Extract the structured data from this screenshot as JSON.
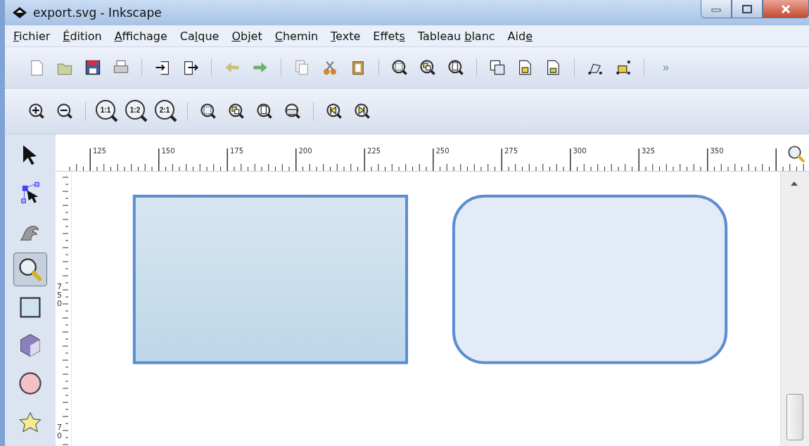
{
  "window": {
    "title": "export.svg - Inkscape"
  },
  "menu": [
    {
      "key": "F",
      "after": "ichier"
    },
    {
      "key": "É",
      "after": "dition"
    },
    {
      "key": "A",
      "after": "ffichage"
    },
    {
      "before": "Ca",
      "key": "l",
      "after": "que"
    },
    {
      "key": "O",
      "after": "bjet"
    },
    {
      "key": "C",
      "after": "hemin"
    },
    {
      "key": "T",
      "after": "exte"
    },
    {
      "before": "Effet",
      "key": "s"
    },
    {
      "before": "Tableau ",
      "key": "b",
      "after": "lanc"
    },
    {
      "before": "Aid",
      "key": "e"
    }
  ],
  "toolbar": {
    "overflow": "»"
  },
  "zoom_toolbar": {
    "ratios": [
      "1:1",
      "1:2",
      "2:1"
    ]
  },
  "tools": [
    {
      "kind": "selector",
      "selected": false
    },
    {
      "kind": "node",
      "selected": false
    },
    {
      "kind": "tweak",
      "selected": false
    },
    {
      "kind": "zoom",
      "selected": true
    },
    {
      "kind": "rect",
      "selected": false
    },
    {
      "kind": "box3d",
      "selected": false
    },
    {
      "kind": "circle",
      "selected": false
    },
    {
      "kind": "star",
      "selected": false
    }
  ],
  "ruler": {
    "labels": [
      "125",
      "150",
      "175",
      "200",
      "225",
      "250",
      "275",
      "300",
      "325",
      "350"
    ]
  },
  "vertical_ruler": {
    "labels": [
      "750",
      "70"
    ]
  },
  "canvas": {
    "shapes": [
      {
        "kind": "rect"
      },
      {
        "kind": "rounded_rect"
      }
    ]
  }
}
